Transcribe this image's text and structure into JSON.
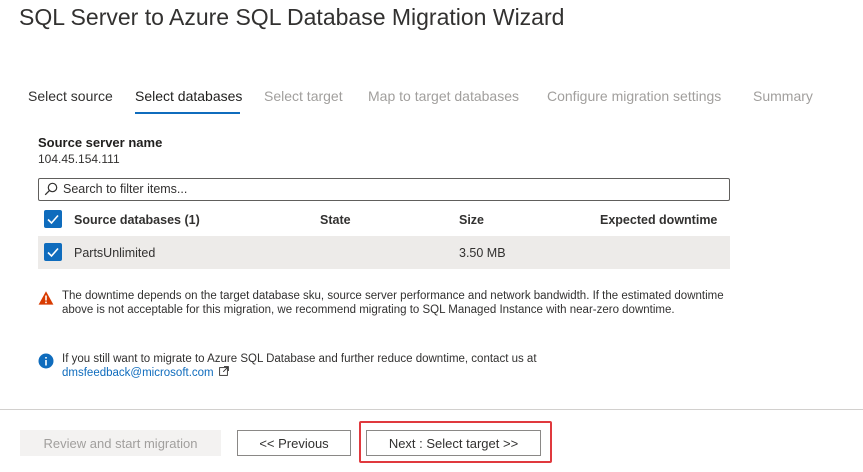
{
  "app": {
    "title": "SQL Server to Azure SQL Database Migration Wizard"
  },
  "tabs": [
    {
      "label": "Select source"
    },
    {
      "label": "Select databases"
    },
    {
      "label": "Select target"
    },
    {
      "label": "Map to target databases"
    },
    {
      "label": "Configure migration settings"
    },
    {
      "label": "Summary"
    }
  ],
  "source": {
    "label": "Source server name",
    "value": "104.45.154.111"
  },
  "search": {
    "placeholder": "Search to filter items..."
  },
  "table": {
    "columns": [
      "Source databases (1)",
      "State",
      "Size",
      "Expected downtime"
    ],
    "rows": [
      {
        "name": "PartsUnlimited",
        "state": "",
        "size": "3.50 MB",
        "downtime": ""
      }
    ]
  },
  "warning": {
    "text": "The downtime depends on the target database sku, source server performance and network bandwidth.  If the estimated downtime above is not acceptable for this migration, we recommend migrating to SQL Managed Instance with near-zero downtime."
  },
  "info": {
    "text": "If you still want to migrate to Azure SQL Database and further reduce downtime, contact us at",
    "link": "dmsfeedback@microsoft.com"
  },
  "footer": {
    "review_label": "Review and start migration",
    "prev_label": "<< Previous",
    "next_label": "Next : Select target >>"
  },
  "colors": {
    "accent": "#0f6cbd",
    "highlight": "#e0393e",
    "warning": "#d83b01"
  }
}
